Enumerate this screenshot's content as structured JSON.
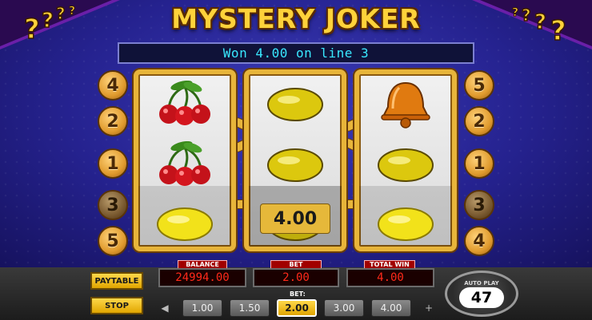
{
  "game": {
    "title": "MYSTERY JOKER",
    "message": "Won 4.00 on line 3",
    "win_amount": "4.00"
  },
  "reels": [
    [
      "cherries-icon",
      "cherries-icon",
      "lemon-icon"
    ],
    [
      "lemon-icon",
      "lemon-icon",
      "lemon-icon"
    ],
    [
      "bell-icon",
      "lemon-icon",
      "lemon-icon"
    ]
  ],
  "paylines": {
    "left": [
      "4",
      "2",
      "1",
      "3",
      "5"
    ],
    "right": [
      "5",
      "2",
      "1",
      "3",
      "4"
    ]
  },
  "meters": {
    "balance_label": "BALANCE",
    "balance": "24994.00",
    "bet_label": "BET",
    "bet": "2.00",
    "total_win_label": "TOTAL WIN",
    "total_win": "4.00"
  },
  "controls": {
    "paytable_label": "PAYTABLE",
    "stop_label": "STOP",
    "bet_caption": "BET:",
    "bet_options": [
      "1.00",
      "1.50",
      "2.00",
      "3.00",
      "4.00"
    ],
    "selected_bet": "2.00",
    "prev_arrow": "◀",
    "next_arrow": "+",
    "autoplay_label": "AUTO PLAY",
    "autoplay_count": "47"
  },
  "colors": {
    "background": "#25228f",
    "frame_gold": "#e8b53a",
    "message_text": "#39e8ff",
    "meter_red": "#ff2a1a",
    "button_yellow": "#ffd84a"
  }
}
